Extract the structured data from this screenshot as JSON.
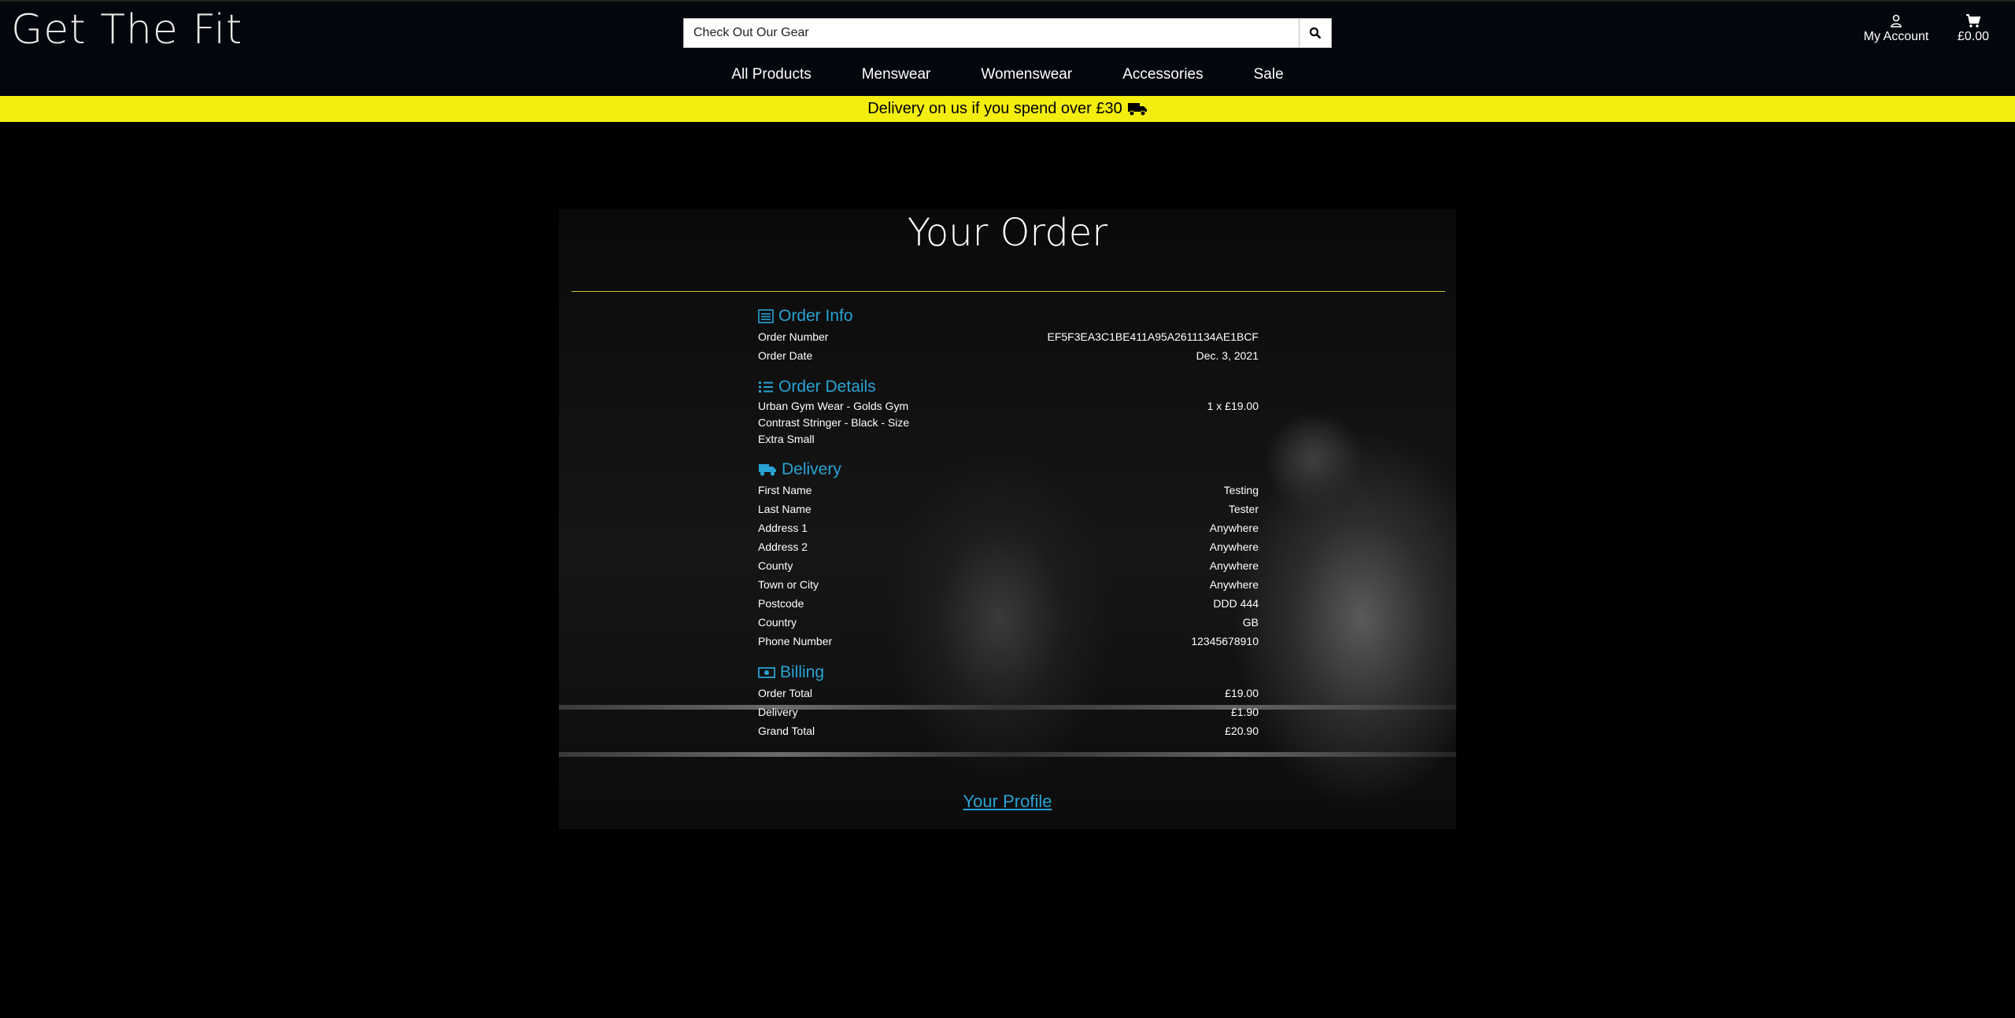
{
  "header": {
    "logo": "Get The Fit",
    "search_placeholder": "Check Out Our Gear",
    "account_label": "My Account",
    "bag_total": "£0.00"
  },
  "nav": [
    "All Products",
    "Menswear",
    "Womenswear",
    "Accessories",
    "Sale"
  ],
  "banner": {
    "text": "Delivery on us if you spend over £30"
  },
  "order": {
    "title": "Your Order",
    "info": {
      "heading": "Order Info",
      "number_label": "Order Number",
      "number": "EF5F3EA3C1BE411A95A2611134AE1BCF",
      "date_label": "Order Date",
      "date": "Dec. 3, 2021"
    },
    "details": {
      "heading": "Order Details",
      "item_name": "Urban Gym Wear - Golds Gym Contrast Stringer - Black - Size Extra Small",
      "item_qty_price": "1 x £19.00"
    },
    "delivery": {
      "heading": "Delivery",
      "rows": [
        {
          "label": "First Name",
          "value": "Testing"
        },
        {
          "label": "Last Name",
          "value": "Tester"
        },
        {
          "label": "Address 1",
          "value": "Anywhere"
        },
        {
          "label": "Address 2",
          "value": "Anywhere"
        },
        {
          "label": "County",
          "value": "Anywhere"
        },
        {
          "label": "Town or City",
          "value": "Anywhere"
        },
        {
          "label": "Postcode",
          "value": "DDD 444"
        },
        {
          "label": "Country",
          "value": "GB"
        },
        {
          "label": "Phone Number",
          "value": "12345678910"
        }
      ]
    },
    "billing": {
      "heading": "Billing",
      "rows": [
        {
          "label": "Order Total",
          "value": "£19.00"
        },
        {
          "label": "Delivery",
          "value": "£1.90"
        },
        {
          "label": "Grand Total",
          "value": "£20.90"
        }
      ]
    },
    "profile_link": "Your Profile"
  },
  "colors": {
    "accent": "#29a3d4",
    "banner": "#f3ee0f",
    "rule": "#c9c632"
  }
}
